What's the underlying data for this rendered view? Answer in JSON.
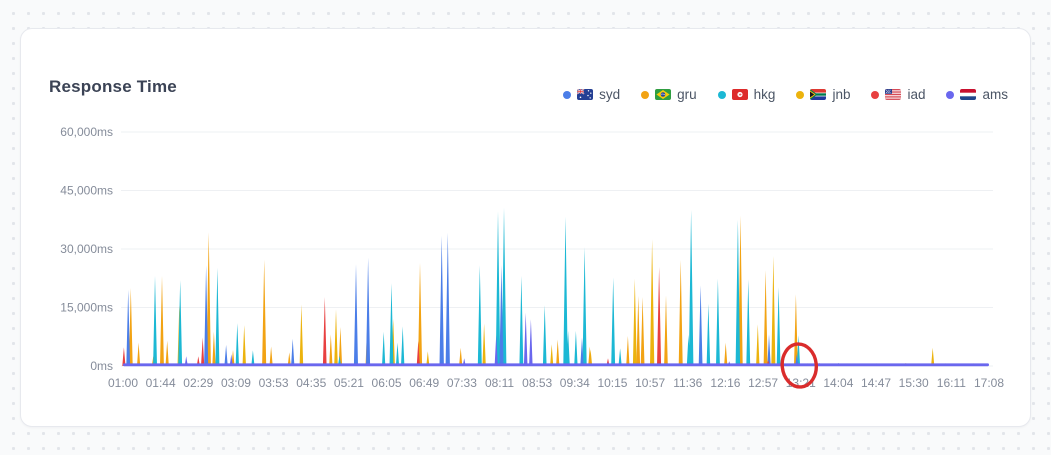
{
  "card": {
    "title": "Response Time"
  },
  "legend": {
    "items": [
      {
        "id": "syd",
        "label": "syd",
        "flag": "australia"
      },
      {
        "id": "gru",
        "label": "gru",
        "flag": "brazil"
      },
      {
        "id": "hkg",
        "label": "hkg",
        "flag": "hong-kong"
      },
      {
        "id": "jnb",
        "label": "jnb",
        "flag": "south-africa"
      },
      {
        "id": "iad",
        "label": "iad",
        "flag": "united-states"
      },
      {
        "id": "ams",
        "label": "ams",
        "flag": "netherlands"
      }
    ]
  },
  "chart_data": {
    "type": "line",
    "subtype": "spiky-latency-timeseries",
    "title": "Response Time",
    "unit": "ms",
    "ylim": [
      0,
      60000
    ],
    "y_ticks": [
      "0ms",
      "15,000ms",
      "30,000ms",
      "45,000ms",
      "60,000ms"
    ],
    "y_tick_values": [
      0,
      15000,
      30000,
      45000,
      60000
    ],
    "x_ticks": [
      "01:00",
      "01:44",
      "02:29",
      "03:09",
      "03:53",
      "04:35",
      "05:21",
      "06:05",
      "06:49",
      "07:33",
      "08:11",
      "08:53",
      "09:34",
      "10:15",
      "10:57",
      "11:36",
      "12:16",
      "12:57",
      "13:21",
      "14:04",
      "14:47",
      "15:30",
      "16:11",
      "17:08"
    ],
    "grid": "horizontal",
    "legend_position": "top-right",
    "baseline_ms": 600,
    "series": [
      {
        "name": "syd",
        "color": "#4b7ee8",
        "spikes": [
          [
            0.006,
            19500
          ],
          [
            0.096,
            25800
          ],
          [
            0.119,
            5400
          ],
          [
            0.196,
            7000
          ],
          [
            0.269,
            26100
          ],
          [
            0.283,
            27800
          ],
          [
            0.368,
            33400
          ],
          [
            0.375,
            34200
          ],
          [
            0.437,
            25900
          ],
          [
            0.53,
            7300
          ],
          [
            0.667,
            20700
          ],
          [
            0.746,
            8100
          ],
          [
            0.778,
            3000
          ],
          [
            0.826,
            800
          ]
        ]
      },
      {
        "name": "gru",
        "color": "#f2a313",
        "spikes": [
          [
            0.009,
            20000
          ],
          [
            0.018,
            6000
          ],
          [
            0.035,
            2500
          ],
          [
            0.045,
            23100
          ],
          [
            0.051,
            6500
          ],
          [
            0.099,
            34300
          ],
          [
            0.105,
            8800
          ],
          [
            0.127,
            4100
          ],
          [
            0.163,
            27300
          ],
          [
            0.171,
            5000
          ],
          [
            0.192,
            3500
          ],
          [
            0.24,
            8100
          ],
          [
            0.251,
            10000
          ],
          [
            0.282,
            10200
          ],
          [
            0.343,
            26500
          ],
          [
            0.39,
            4700
          ],
          [
            0.439,
            13400
          ],
          [
            0.502,
            6800
          ],
          [
            0.539,
            5000
          ],
          [
            0.583,
            7700
          ],
          [
            0.595,
            18000
          ],
          [
            0.6,
            17700
          ],
          [
            0.627,
            18100
          ],
          [
            0.644,
            27200
          ],
          [
            0.696,
            6000
          ],
          [
            0.713,
            38600
          ],
          [
            0.742,
            24600
          ],
          [
            0.777,
            18400
          ],
          [
            0.79,
            700
          ],
          [
            0.797,
            500
          ],
          [
            0.804,
            800
          ],
          [
            0.812,
            400
          ],
          [
            0.82,
            600
          ],
          [
            0.828,
            500
          ],
          [
            0.836,
            700
          ],
          [
            0.845,
            400
          ],
          [
            0.853,
            600
          ],
          [
            0.862,
            500
          ],
          [
            0.87,
            700
          ],
          [
            0.878,
            400
          ],
          [
            0.887,
            600
          ],
          [
            0.895,
            500
          ],
          [
            0.904,
            800
          ],
          [
            0.912,
            500
          ],
          [
            0.921,
            600
          ],
          [
            0.942,
            500
          ],
          [
            0.95,
            700
          ],
          [
            0.958,
            400
          ],
          [
            0.966,
            600
          ],
          [
            0.974,
            500
          ],
          [
            0.982,
            700
          ],
          [
            0.99,
            500
          ]
        ]
      },
      {
        "name": "hkg",
        "color": "#1cb8d4",
        "spikes": [
          [
            0.037,
            23100
          ],
          [
            0.066,
            22000
          ],
          [
            0.109,
            25200
          ],
          [
            0.132,
            11000
          ],
          [
            0.15,
            4000
          ],
          [
            0.25,
            2600
          ],
          [
            0.301,
            8800
          ],
          [
            0.31,
            21200
          ],
          [
            0.317,
            6000
          ],
          [
            0.323,
            10200
          ],
          [
            0.412,
            25800
          ],
          [
            0.433,
            39700
          ],
          [
            0.44,
            40600
          ],
          [
            0.46,
            23100
          ],
          [
            0.487,
            15600
          ],
          [
            0.511,
            38300
          ],
          [
            0.514,
            9000
          ],
          [
            0.523,
            9000
          ],
          [
            0.533,
            30500
          ],
          [
            0.566,
            22700
          ],
          [
            0.574,
            4500
          ],
          [
            0.653,
            8000
          ],
          [
            0.656,
            40000
          ],
          [
            0.676,
            16000
          ],
          [
            0.687,
            22400
          ],
          [
            0.71,
            37500
          ],
          [
            0.722,
            22200
          ],
          [
            0.757,
            20200
          ],
          [
            0.78,
            7900
          ]
        ]
      },
      {
        "name": "jnb",
        "color": "#ecb30d",
        "spikes": [
          [
            0.065,
            15500
          ],
          [
            0.14,
            10500
          ],
          [
            0.206,
            15800
          ],
          [
            0.246,
            14500
          ],
          [
            0.312,
            12100
          ],
          [
            0.352,
            3800
          ],
          [
            0.417,
            10900
          ],
          [
            0.495,
            5600
          ],
          [
            0.54,
            4200
          ],
          [
            0.591,
            22400
          ],
          [
            0.611,
            32500
          ],
          [
            0.733,
            10700
          ],
          [
            0.751,
            28200
          ],
          [
            0.935,
            4700
          ]
        ]
      },
      {
        "name": "iad",
        "color": "#e84040",
        "spikes": [
          [
            0.001,
            4800
          ],
          [
            0.087,
            2500
          ],
          [
            0.092,
            7300
          ],
          [
            0.233,
            17700
          ],
          [
            0.341,
            6400
          ],
          [
            0.56,
            2000
          ],
          [
            0.619,
            25400
          ],
          [
            0.745,
            1500
          ]
        ]
      },
      {
        "name": "ams",
        "color": "#6a67ee",
        "spikes": [
          [
            0.073,
            2500
          ],
          [
            0.125,
            3000
          ],
          [
            0.394,
            2000
          ],
          [
            0.431,
            7900
          ],
          [
            0.465,
            13700
          ],
          [
            0.471,
            12000
          ],
          [
            0.56,
            1000
          ],
          [
            0.7,
            1200
          ]
        ]
      }
    ],
    "annotation": {
      "type": "hand-drawn-circle",
      "x_tick": "13:21",
      "y_value": 0,
      "color": "#da2c2c",
      "meaning": "highlights where response times flat-line near 0ms"
    }
  }
}
